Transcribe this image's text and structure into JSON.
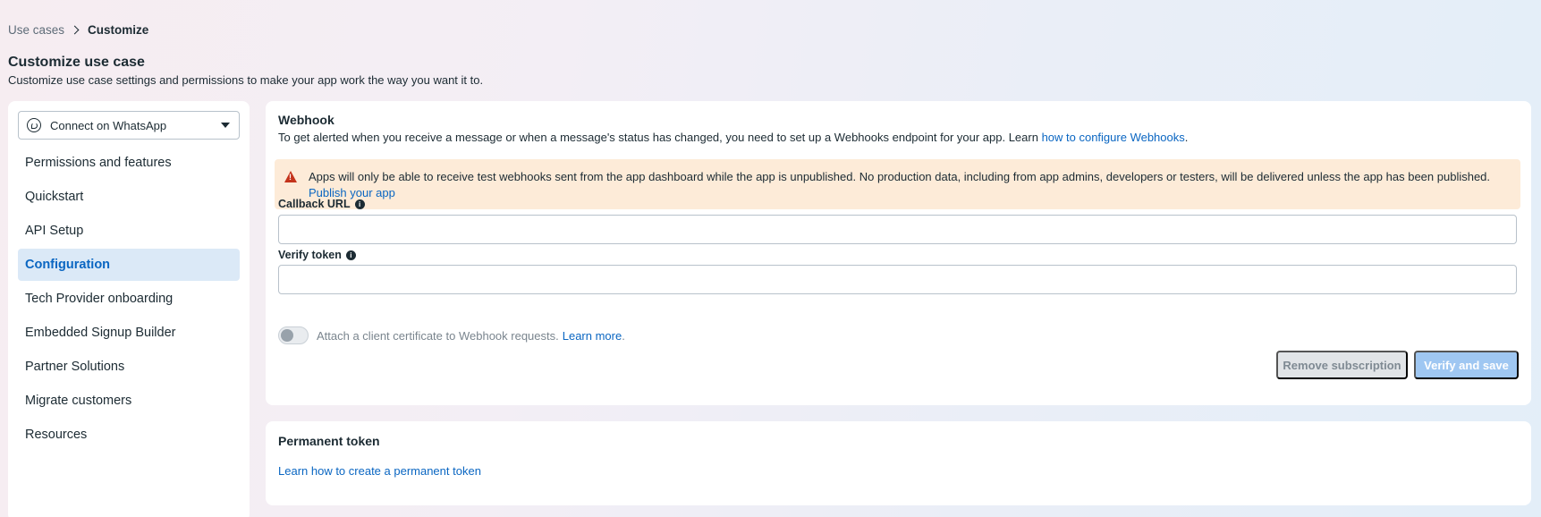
{
  "breadcrumb": {
    "parent": "Use cases",
    "current": "Customize"
  },
  "header": {
    "title": "Customize use case",
    "subtitle": "Customize use case settings and permissions to make your app work the way you want it to."
  },
  "sidebar": {
    "selector": {
      "label": "Connect on WhatsApp",
      "icon": "whatsapp-icon"
    },
    "items": [
      {
        "label": "Permissions and features"
      },
      {
        "label": "Quickstart"
      },
      {
        "label": "API Setup"
      },
      {
        "label": "Configuration",
        "active": true
      },
      {
        "label": "Tech Provider onboarding"
      },
      {
        "label": "Embedded Signup Builder"
      },
      {
        "label": "Partner Solutions"
      },
      {
        "label": "Migrate customers"
      },
      {
        "label": "Resources"
      }
    ]
  },
  "webhook": {
    "title": "Webhook",
    "description": "To get alerted when you receive a message or when a message's status has changed, you need to set up a Webhooks endpoint for your app. Learn ",
    "description_link": "how to configure Webhooks",
    "description_end": ".",
    "alert": {
      "icon": "warning-icon",
      "text": "Apps will only be able to receive test webhooks sent from the app dashboard while the app is unpublished. No production data, including from app admins, developers or testers, will be delivered unless the app has been published. ",
      "link": "Publish your app"
    },
    "callback_label": "Callback URL",
    "callback_value": "",
    "verify_label": "Verify token",
    "verify_value": "",
    "toggle_text": "Attach a client certificate to Webhook requests. ",
    "toggle_link": "Learn more",
    "toggle_end": ".",
    "toggle_on": false,
    "remove_button": "Remove subscription",
    "verify_button": "Verify and save"
  },
  "token": {
    "title": "Permanent token",
    "link": "Learn how to create a permanent token"
  },
  "colors": {
    "accent": "#0a66c2",
    "active_bg": "#dbe9f7",
    "alert_bg": "#fdebd8",
    "warning": "#c4331b"
  }
}
